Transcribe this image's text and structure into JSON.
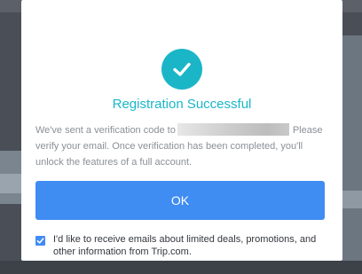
{
  "dialog": {
    "title": "Registration Successful",
    "message_before": "We've sent a verification code to",
    "message_after": "Please verify your email. Once verification has been completed, you'll unlock the features of a full account.",
    "ok_label": "OK",
    "consent_checked": true,
    "consent_label": "I'd like to receive emails about limited deals, promotions, and other information from Trip.com."
  },
  "icons": {
    "success": "check-circle-icon",
    "checkbox": "checkmark-icon"
  },
  "colors": {
    "accent": "#1ab6c8",
    "button": "#3f8cf3",
    "overlay": "#4a4f57",
    "text_muted": "#8a8f96",
    "text_body": "#33373d"
  }
}
